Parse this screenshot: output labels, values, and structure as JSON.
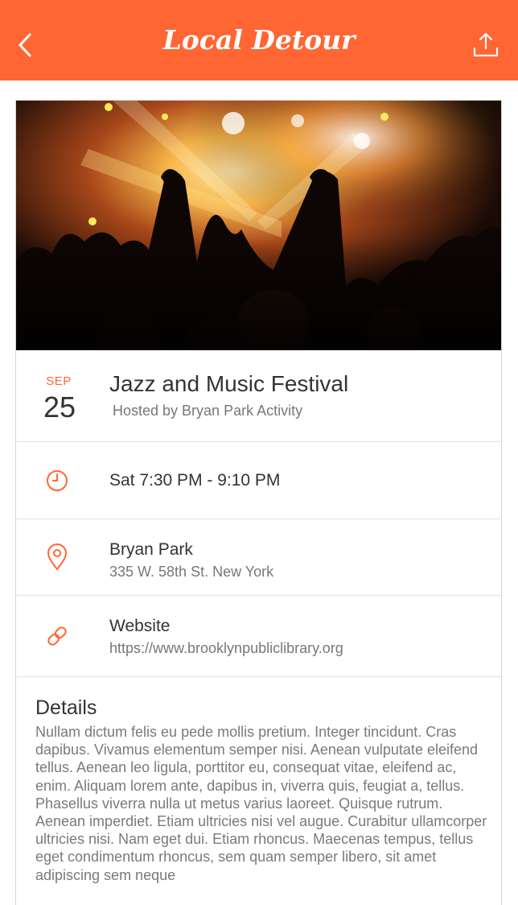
{
  "app": {
    "title": "Local Detour",
    "accent_color": "#ff6633",
    "icons": {
      "back": "chevron-left-icon",
      "share": "share-upload-icon"
    }
  },
  "event": {
    "image": "concert-crowd-photo",
    "date": {
      "month": "SEP",
      "day": "25"
    },
    "title": "Jazz and Music Festival",
    "host": "Hosted by Bryan Park Activity"
  },
  "time": {
    "icon": "clock-icon",
    "text": "Sat 7:30 PM - 9:10 PM"
  },
  "location": {
    "icon": "map-pin-icon",
    "name": "Bryan Park",
    "address": "335 W. 58th St. New York"
  },
  "website": {
    "icon": "link-icon",
    "label": "Website",
    "url": "https://www.brooklynpubliclibrary.org"
  },
  "details": {
    "heading": "Details",
    "body": "Nullam dictum felis eu pede mollis pretium. Integer tincidunt. Cras dapibus. Vivamus elementum semper nisi. Aenean vulputate eleifend tellus. Aenean leo ligula, porttitor eu, consequat vitae, eleifend ac, enim. Aliquam lorem ante, dapibus in, viverra quis, feugiat a, tellus. Phasellus viverra nulla ut metus varius laoreet. Quisque rutrum. Aenean imperdiet. Etiam ultricies nisi vel augue. Curabitur ullamcorper ultricies nisi. Nam eget dui. Etiam rhoncus. Maecenas tempus, tellus eget condimentum rhoncus, sem quam semper libero, sit amet adipiscing sem neque"
  }
}
